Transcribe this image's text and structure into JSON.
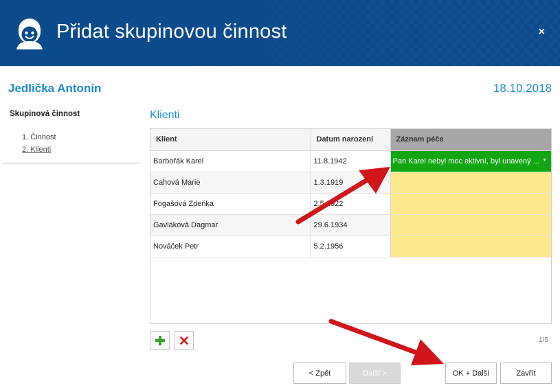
{
  "window": {
    "title": "Přidat skupinovou činnost",
    "close_label": "×"
  },
  "header": {
    "person_name": "Jedlička Antonín",
    "date": "18.10.2018"
  },
  "sidebar": {
    "heading": "Skupinová činnost",
    "steps": [
      {
        "label": "1. Činnost"
      },
      {
        "label": "2. Klienti"
      }
    ]
  },
  "section_title": "Klienti",
  "table": {
    "columns": [
      "Klient",
      "Datum narození",
      "Záznam péče"
    ],
    "rows": [
      {
        "client": "Barbořák Karel",
        "birth_date": "11.8.1942",
        "note": "Pan Karel nebyl moc aktivní, byl unavený ..."
      },
      {
        "client": "Cahová Marie",
        "birth_date": "1.3.1919",
        "note": ""
      },
      {
        "client": "Fogašová Zdeňka",
        "birth_date": "2.5.1922",
        "note": ""
      },
      {
        "client": "Gavláková Dagmar",
        "birth_date": "29.6.1934",
        "note": ""
      },
      {
        "client": "Nováček Petr",
        "birth_date": "5.2.1956",
        "note": ""
      }
    ]
  },
  "pager": "1/5",
  "buttons": {
    "back": "< Zpět",
    "next": "Další >",
    "ok_next": "OK + Další",
    "close": "Zavřít"
  },
  "icons": {
    "logo": "user-face-icon",
    "add": "plus-icon",
    "delete": "delete-x-icon",
    "caret": "chevron-down-icon",
    "annotations": "red-arrow-icon"
  },
  "colors": {
    "titlebar": "#0b4a8b",
    "accent": "#1a8ad4",
    "active_cell": "#13a613",
    "note_cell": "#fde98b",
    "annotation_arrow": "#d0161b"
  }
}
